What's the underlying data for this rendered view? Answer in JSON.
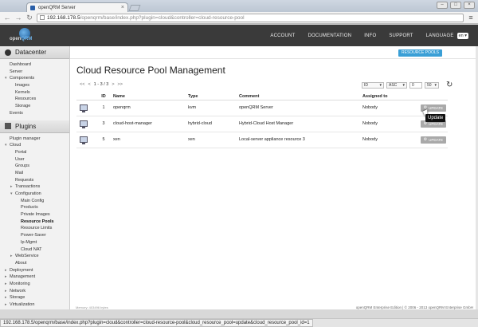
{
  "browser": {
    "tab_title": "openQRM Server",
    "url_host": "192.168.178.5",
    "url_path": "/openqrm/base/index.php?plugin=cloud&controller=cloud-resource-pool",
    "status_url": "192.168.178.5/openqrm/base/index.php?plugin=cloud&controller=cloud-resource-pool&cloud_resource_pool=update&cloud_resource_pool_id=1"
  },
  "header": {
    "logo_prefix": "open",
    "logo_letter": "Q",
    "logo_suffix": "RM",
    "nav": [
      "ACCOUNT",
      "DOCUMENTATION",
      "INFO",
      "SUPPORT"
    ],
    "language_label": "LANGUAGE",
    "language_value": "en"
  },
  "sidebar": {
    "datacenter_title": "Datacenter",
    "datacenter_items": [
      {
        "label": "Dashboard",
        "indent": 0,
        "twisty": ""
      },
      {
        "label": "Server",
        "indent": 0,
        "twisty": ""
      },
      {
        "label": "Components",
        "indent": 0,
        "twisty": "▾"
      },
      {
        "label": "Images",
        "indent": 1,
        "twisty": ""
      },
      {
        "label": "Kernels",
        "indent": 1,
        "twisty": ""
      },
      {
        "label": "Resources",
        "indent": 1,
        "twisty": ""
      },
      {
        "label": "Storage",
        "indent": 1,
        "twisty": ""
      },
      {
        "label": "Events",
        "indent": 0,
        "twisty": ""
      }
    ],
    "plugins_title": "Plugins",
    "plugin_items": [
      {
        "label": "Plugin manager",
        "indent": 0,
        "twisty": ""
      },
      {
        "label": "Cloud",
        "indent": 0,
        "twisty": "▾"
      },
      {
        "label": "Portal",
        "indent": 1,
        "twisty": ""
      },
      {
        "label": "User",
        "indent": 1,
        "twisty": ""
      },
      {
        "label": "Groups",
        "indent": 1,
        "twisty": ""
      },
      {
        "label": "Mail",
        "indent": 1,
        "twisty": ""
      },
      {
        "label": "Requests",
        "indent": 1,
        "twisty": ""
      },
      {
        "label": "Transactions",
        "indent": 1,
        "twisty": "▸"
      },
      {
        "label": "Configuration",
        "indent": 1,
        "twisty": "▾"
      },
      {
        "label": "Main Config",
        "indent": 2,
        "twisty": ""
      },
      {
        "label": "Products",
        "indent": 2,
        "twisty": ""
      },
      {
        "label": "Private Images",
        "indent": 2,
        "twisty": ""
      },
      {
        "label": "Resource Pools",
        "indent": 2,
        "twisty": "",
        "bold": true
      },
      {
        "label": "Resource Limits",
        "indent": 2,
        "twisty": ""
      },
      {
        "label": "Power-Saver",
        "indent": 2,
        "twisty": ""
      },
      {
        "label": "Ip-Mgmt",
        "indent": 2,
        "twisty": ""
      },
      {
        "label": "Cloud NAT",
        "indent": 2,
        "twisty": ""
      },
      {
        "label": "WebService",
        "indent": 1,
        "twisty": "▸"
      },
      {
        "label": "About",
        "indent": 1,
        "twisty": ""
      },
      {
        "label": "Deployment",
        "indent": 0,
        "twisty": "▸"
      },
      {
        "label": "Management",
        "indent": 0,
        "twisty": "▸"
      },
      {
        "label": "Monitoring",
        "indent": 0,
        "twisty": "▸"
      },
      {
        "label": "Network",
        "indent": 0,
        "twisty": "▸"
      },
      {
        "label": "Storage",
        "indent": 0,
        "twisty": "▸"
      },
      {
        "label": "Virtualization",
        "indent": 0,
        "twisty": "▸"
      }
    ]
  },
  "main": {
    "resource_pools_button": "RESOURCE POOLS",
    "title": "Cloud Resource Pool Management",
    "pager": {
      "first": "<<",
      "prev": "<",
      "info": "1 - 3 / 3",
      "next": ">",
      "last": ">>"
    },
    "controls": {
      "sort_field": "ID",
      "sort_order": "ASC",
      "offset": "0",
      "limit": "50"
    },
    "columns": {
      "id": "ID",
      "name": "Name",
      "type": "Type",
      "comment": "Comment",
      "assigned": "Assigned to"
    },
    "rows": [
      {
        "id": "1",
        "name": "openqrm",
        "type": "kvm",
        "comment": "openQRM Server",
        "assigned": "Nobody",
        "action": "UPDATE"
      },
      {
        "id": "3",
        "name": "cloud-host-manager",
        "type": "hybrid-cloud",
        "comment": "Hybrid-Cloud Host Manager",
        "assigned": "Nobody",
        "action": "UPDATE"
      },
      {
        "id": "5",
        "name": "xen",
        "type": "xen",
        "comment": "Local-server appliance resource 3",
        "assigned": "Nobody",
        "action": "UPDATE"
      }
    ],
    "tooltip": "Update",
    "memory": "Memory: 403496 bytes",
    "copyright": "openQRM Enterprise Edition | © 2006 - 2013 openQRM Enterprise GmbH"
  }
}
